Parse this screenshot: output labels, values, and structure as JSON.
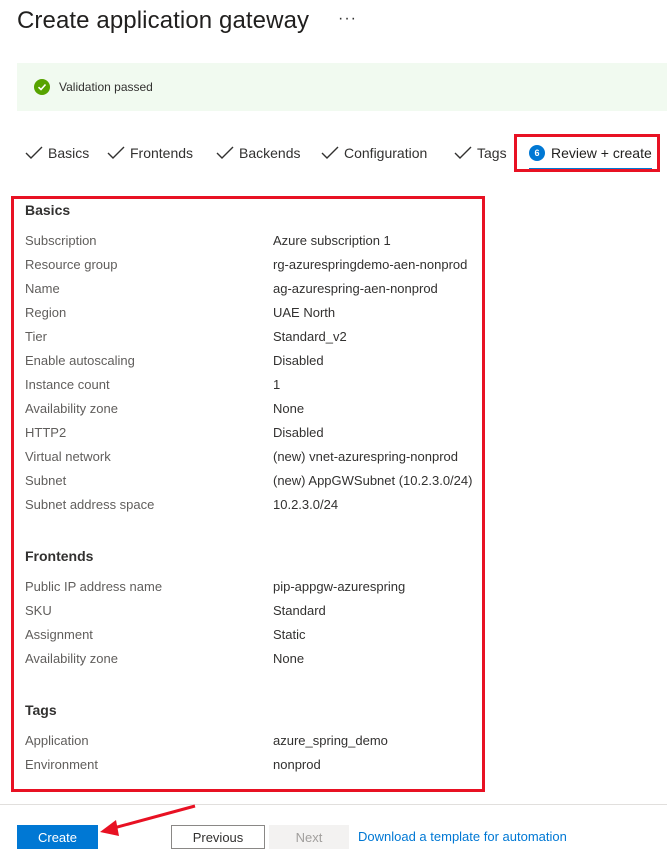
{
  "page": {
    "title": "Create application gateway",
    "more_glyph": "···"
  },
  "banner": {
    "text": "Validation passed",
    "icon": "check-circle-icon",
    "color": "#57a300"
  },
  "tabs": [
    {
      "label": "Basics",
      "state": "complete"
    },
    {
      "label": "Frontends",
      "state": "complete"
    },
    {
      "label": "Backends",
      "state": "complete"
    },
    {
      "label": "Configuration",
      "state": "complete"
    },
    {
      "label": "Tags",
      "state": "complete"
    },
    {
      "number": "6",
      "label": "Review + create",
      "state": "active"
    }
  ],
  "sections": [
    {
      "title": "Basics",
      "rows": [
        {
          "label": "Subscription",
          "value": "Azure subscription 1"
        },
        {
          "label": "Resource group",
          "value": "rg-azurespringdemo-aen-nonprod"
        },
        {
          "label": "Name",
          "value": "ag-azurespring-aen-nonprod"
        },
        {
          "label": "Region",
          "value": "UAE North"
        },
        {
          "label": "Tier",
          "value": "Standard_v2"
        },
        {
          "label": "Enable autoscaling",
          "value": "Disabled"
        },
        {
          "label": "Instance count",
          "value": "1"
        },
        {
          "label": "Availability zone",
          "value": "None"
        },
        {
          "label": "HTTP2",
          "value": "Disabled"
        },
        {
          "label": "Virtual network",
          "value": "(new) vnet-azurespring-nonprod"
        },
        {
          "label": "Subnet",
          "value": "(new) AppGWSubnet (10.2.3.0/24)"
        },
        {
          "label": "Subnet address space",
          "value": "10.2.3.0/24"
        }
      ]
    },
    {
      "title": "Frontends",
      "rows": [
        {
          "label": "Public IP address name",
          "value": "pip-appgw-azurespring"
        },
        {
          "label": "SKU",
          "value": "Standard"
        },
        {
          "label": "Assignment",
          "value": "Static"
        },
        {
          "label": "Availability zone",
          "value": "None"
        }
      ]
    },
    {
      "title": "Tags",
      "rows": [
        {
          "label": "Application",
          "value": "azure_spring_demo"
        },
        {
          "label": "Environment",
          "value": "nonprod"
        }
      ]
    }
  ],
  "footer": {
    "create_label": "Create",
    "previous_label": "Previous",
    "next_label": "Next",
    "download_link": "Download a template for automation"
  },
  "colors": {
    "accent": "#0078d4",
    "annotation": "#e81123"
  }
}
